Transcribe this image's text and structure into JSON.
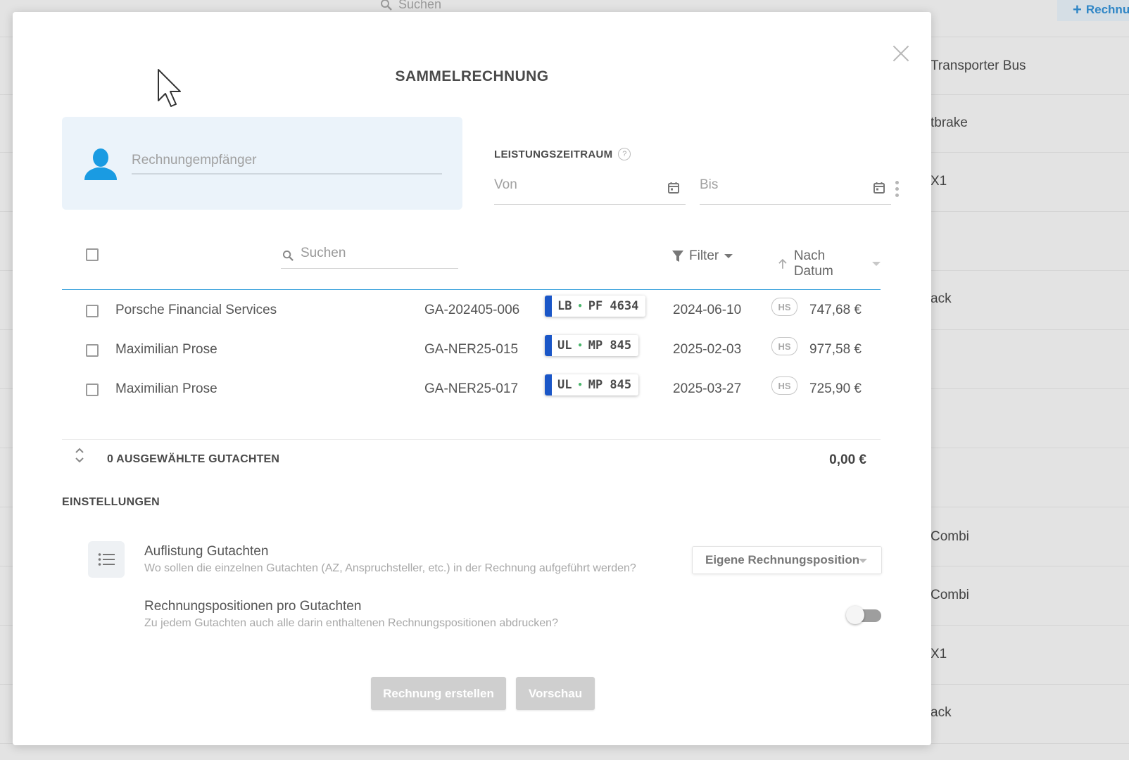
{
  "background": {
    "search_label": "Suchen",
    "add_button_label": "Rechnu",
    "row_labels": [
      "Transporter Bus",
      "tbrake",
      "X1",
      "ack",
      "Combi",
      "Combi",
      "X1",
      "ack"
    ]
  },
  "dialog": {
    "title": "SAMMELRECHNUNG",
    "recipient_placeholder": "Rechnungempfänger",
    "period": {
      "label": "LEISTUNGSZEITRAUM",
      "help_symbol": "?",
      "from_placeholder": "Von",
      "to_placeholder": "Bis"
    },
    "list": {
      "search_placeholder": "Suchen",
      "filter_label": "Filter",
      "sort_label": "Nach Datum",
      "rows": [
        {
          "name": "Porsche Financial Services",
          "ref": "GA-202405-006",
          "plate_left": "LB",
          "plate_right": "PF 4634",
          "date": "2024-06-10",
          "badge": "HS",
          "amount": "747,68 €"
        },
        {
          "name": "Maximilian Prose",
          "ref": "GA-NER25-015",
          "plate_left": "UL",
          "plate_right": "MP 845",
          "date": "2025-02-03",
          "badge": "HS",
          "amount": "977,58 €"
        },
        {
          "name": "Maximilian Prose",
          "ref": "GA-NER25-017",
          "plate_left": "UL",
          "plate_right": "MP 845",
          "date": "2025-03-27",
          "badge": "HS",
          "amount": "725,90 €"
        }
      ]
    },
    "summary": {
      "selected_label": "0 AUSGEWÄHLTE GUTACHTEN",
      "total": "0,00 €"
    },
    "settings": {
      "title": "EINSTELLUNGEN",
      "listing": {
        "name": "Auflistung Gutachten",
        "description": "Wo sollen die einzelnen Gutachten (AZ, Anspruchsteller, etc.) in der Rechnung aufgeführt werden?",
        "selected_option": "Eigene Rechnungsposition"
      },
      "positions": {
        "name": "Rechnungspositionen pro Gutachten",
        "description": "Zu jedem Gutachten auch alle darin enthaltenen Rechnungspositionen abdrucken?",
        "enabled": false
      }
    },
    "buttons": {
      "create": "Rechnung erstellen",
      "preview": "Vorschau"
    }
  },
  "colors": {
    "accent": "#3aa2dc",
    "avatar": "#1a9be2",
    "plate_blue": "#1a56c7",
    "plate_dot": "#4ab56b",
    "recipient_bg": "#ebf3fa",
    "button_disabled": "#cfcfcf"
  }
}
